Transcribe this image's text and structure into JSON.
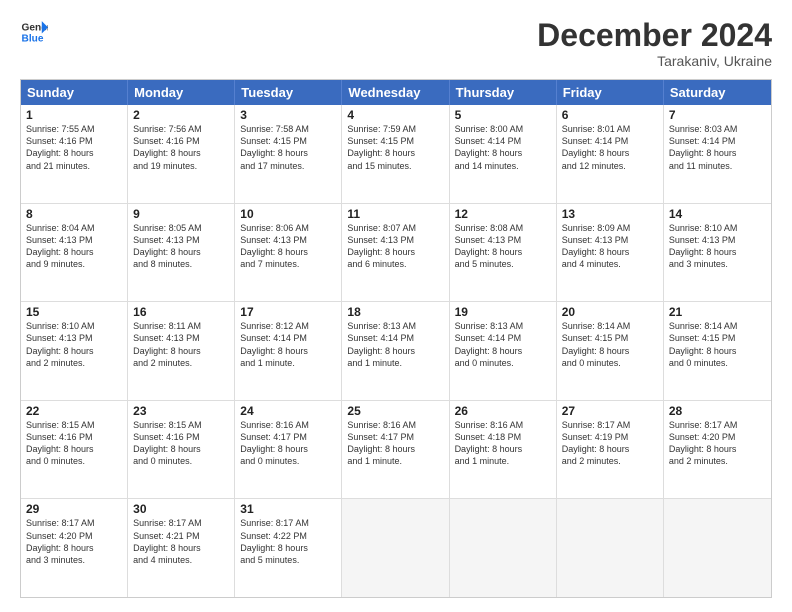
{
  "header": {
    "logo_line1": "General",
    "logo_line2": "Blue",
    "month": "December 2024",
    "location": "Tarakaniv, Ukraine"
  },
  "days_of_week": [
    "Sunday",
    "Monday",
    "Tuesday",
    "Wednesday",
    "Thursday",
    "Friday",
    "Saturday"
  ],
  "weeks": [
    [
      {
        "day": "1",
        "info": "Sunrise: 7:55 AM\nSunset: 4:16 PM\nDaylight: 8 hours\nand 21 minutes."
      },
      {
        "day": "2",
        "info": "Sunrise: 7:56 AM\nSunset: 4:16 PM\nDaylight: 8 hours\nand 19 minutes."
      },
      {
        "day": "3",
        "info": "Sunrise: 7:58 AM\nSunset: 4:15 PM\nDaylight: 8 hours\nand 17 minutes."
      },
      {
        "day": "4",
        "info": "Sunrise: 7:59 AM\nSunset: 4:15 PM\nDaylight: 8 hours\nand 15 minutes."
      },
      {
        "day": "5",
        "info": "Sunrise: 8:00 AM\nSunset: 4:14 PM\nDaylight: 8 hours\nand 14 minutes."
      },
      {
        "day": "6",
        "info": "Sunrise: 8:01 AM\nSunset: 4:14 PM\nDaylight: 8 hours\nand 12 minutes."
      },
      {
        "day": "7",
        "info": "Sunrise: 8:03 AM\nSunset: 4:14 PM\nDaylight: 8 hours\nand 11 minutes."
      }
    ],
    [
      {
        "day": "8",
        "info": "Sunrise: 8:04 AM\nSunset: 4:13 PM\nDaylight: 8 hours\nand 9 minutes."
      },
      {
        "day": "9",
        "info": "Sunrise: 8:05 AM\nSunset: 4:13 PM\nDaylight: 8 hours\nand 8 minutes."
      },
      {
        "day": "10",
        "info": "Sunrise: 8:06 AM\nSunset: 4:13 PM\nDaylight: 8 hours\nand 7 minutes."
      },
      {
        "day": "11",
        "info": "Sunrise: 8:07 AM\nSunset: 4:13 PM\nDaylight: 8 hours\nand 6 minutes."
      },
      {
        "day": "12",
        "info": "Sunrise: 8:08 AM\nSunset: 4:13 PM\nDaylight: 8 hours\nand 5 minutes."
      },
      {
        "day": "13",
        "info": "Sunrise: 8:09 AM\nSunset: 4:13 PM\nDaylight: 8 hours\nand 4 minutes."
      },
      {
        "day": "14",
        "info": "Sunrise: 8:10 AM\nSunset: 4:13 PM\nDaylight: 8 hours\nand 3 minutes."
      }
    ],
    [
      {
        "day": "15",
        "info": "Sunrise: 8:10 AM\nSunset: 4:13 PM\nDaylight: 8 hours\nand 2 minutes."
      },
      {
        "day": "16",
        "info": "Sunrise: 8:11 AM\nSunset: 4:13 PM\nDaylight: 8 hours\nand 2 minutes."
      },
      {
        "day": "17",
        "info": "Sunrise: 8:12 AM\nSunset: 4:14 PM\nDaylight: 8 hours\nand 1 minute."
      },
      {
        "day": "18",
        "info": "Sunrise: 8:13 AM\nSunset: 4:14 PM\nDaylight: 8 hours\nand 1 minute."
      },
      {
        "day": "19",
        "info": "Sunrise: 8:13 AM\nSunset: 4:14 PM\nDaylight: 8 hours\nand 0 minutes."
      },
      {
        "day": "20",
        "info": "Sunrise: 8:14 AM\nSunset: 4:15 PM\nDaylight: 8 hours\nand 0 minutes."
      },
      {
        "day": "21",
        "info": "Sunrise: 8:14 AM\nSunset: 4:15 PM\nDaylight: 8 hours\nand 0 minutes."
      }
    ],
    [
      {
        "day": "22",
        "info": "Sunrise: 8:15 AM\nSunset: 4:16 PM\nDaylight: 8 hours\nand 0 minutes."
      },
      {
        "day": "23",
        "info": "Sunrise: 8:15 AM\nSunset: 4:16 PM\nDaylight: 8 hours\nand 0 minutes."
      },
      {
        "day": "24",
        "info": "Sunrise: 8:16 AM\nSunset: 4:17 PM\nDaylight: 8 hours\nand 0 minutes."
      },
      {
        "day": "25",
        "info": "Sunrise: 8:16 AM\nSunset: 4:17 PM\nDaylight: 8 hours\nand 1 minute."
      },
      {
        "day": "26",
        "info": "Sunrise: 8:16 AM\nSunset: 4:18 PM\nDaylight: 8 hours\nand 1 minute."
      },
      {
        "day": "27",
        "info": "Sunrise: 8:17 AM\nSunset: 4:19 PM\nDaylight: 8 hours\nand 2 minutes."
      },
      {
        "day": "28",
        "info": "Sunrise: 8:17 AM\nSunset: 4:20 PM\nDaylight: 8 hours\nand 2 minutes."
      }
    ],
    [
      {
        "day": "29",
        "info": "Sunrise: 8:17 AM\nSunset: 4:20 PM\nDaylight: 8 hours\nand 3 minutes."
      },
      {
        "day": "30",
        "info": "Sunrise: 8:17 AM\nSunset: 4:21 PM\nDaylight: 8 hours\nand 4 minutes."
      },
      {
        "day": "31",
        "info": "Sunrise: 8:17 AM\nSunset: 4:22 PM\nDaylight: 8 hours\nand 5 minutes."
      },
      {
        "day": "",
        "info": ""
      },
      {
        "day": "",
        "info": ""
      },
      {
        "day": "",
        "info": ""
      },
      {
        "day": "",
        "info": ""
      }
    ]
  ]
}
